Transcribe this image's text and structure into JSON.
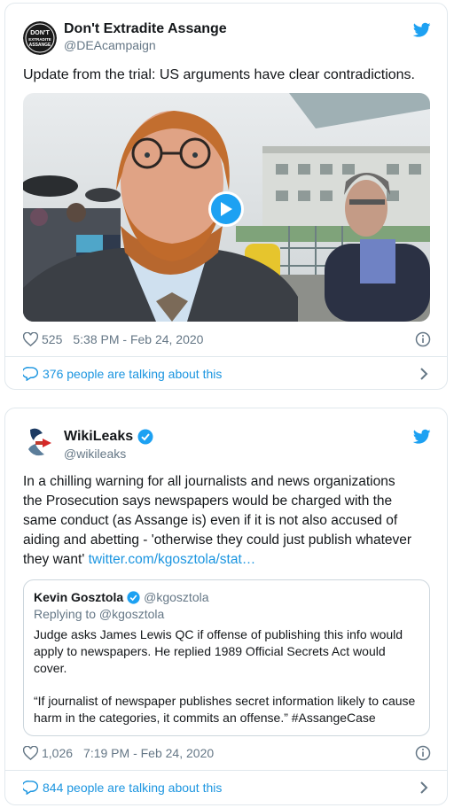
{
  "tweets": [
    {
      "name": "Don't Extradite Assange",
      "handle": "@DEAcampaign",
      "avatar_text": [
        "DON'T",
        "EXTRADITE",
        "ASSANGE"
      ],
      "text": "Update from the trial: US arguments have clear contradictions.",
      "likes": "525",
      "timestamp": "5:38 PM - Feb 24, 2020",
      "talking": "376 people are talking about this"
    },
    {
      "name": "WikiLeaks",
      "handle": "@wikileaks",
      "verified": true,
      "text_lines": [
        "In a chilling warning for all journalists and news organizations",
        "the Prosecution says newspapers would be charged with the",
        "same conduct (as Assange is) even if it is not also accused of",
        "aiding and abetting -  'otherwise they could just publish whatever",
        "they want'"
      ],
      "link": "twitter.com/kgosztola/stat…",
      "quote": {
        "name": "Kevin Gosztola",
        "handle": "@kgosztola",
        "replying": "Replying to @kgosztola",
        "para1": [
          "Judge asks James Lewis QC if offense of publishing this info would",
          "apply to newspapers. He replied 1989 Official Secrets Act would",
          "cover."
        ],
        "para2": [
          "“If journalist of newspaper publishes secret information likely to cause",
          "harm in the categories, it commits an offense.” #AssangeCase"
        ]
      },
      "likes": "1,026",
      "timestamp": "7:19 PM - Feb 24, 2020",
      "talking": "844 people are talking about this"
    }
  ],
  "icons": [
    "twitter-bird-icon",
    "heart-icon",
    "info-icon",
    "comment-icon",
    "chevron-right-icon",
    "play-icon",
    "verified-badge-icon"
  ],
  "colors": {
    "accent": "#1da1f2",
    "link": "#1b95e0",
    "muted": "#657786",
    "border": "#e1e8ed"
  }
}
